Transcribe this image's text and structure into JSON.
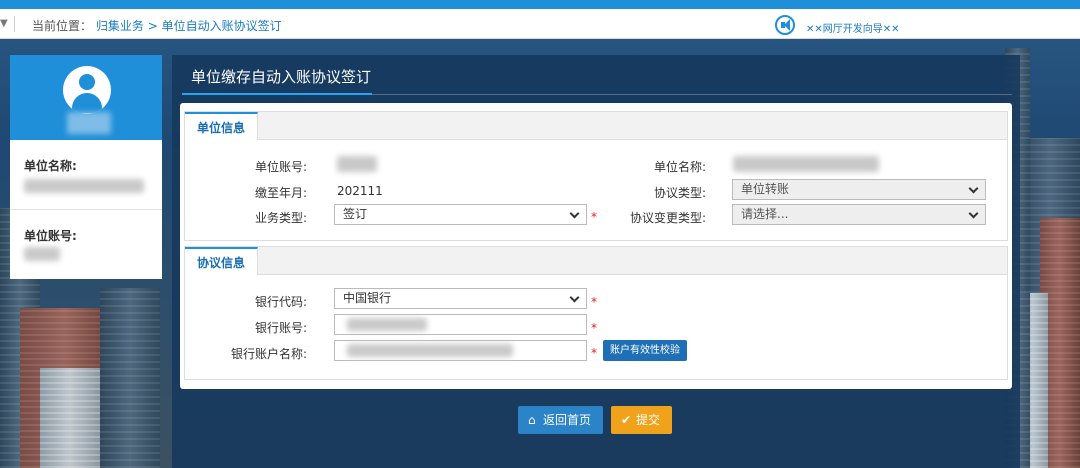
{
  "breadcrumb": {
    "prefix": "当前位置：",
    "level1": "归集业务",
    "separator": ">",
    "level2": "单位自动入账协议签订"
  },
  "guide_link": "✕✕网厅开发向导✕✕",
  "sidebar": {
    "unit_name_label": "单位名称:",
    "unit_account_label": "单位账号:"
  },
  "panel": {
    "title": "单位缴存自动入账协议签订"
  },
  "unit_info": {
    "section_title": "单位信息",
    "account_label": "单位账号:",
    "name_label": "单位名称:",
    "paid_until_label": "缴至年月:",
    "paid_until_value": "202111",
    "agreement_type_label": "协议类型:",
    "agreement_type_value": "单位转账",
    "business_type_label": "业务类型:",
    "business_type_value": "签订",
    "change_type_label": "协议变更类型:",
    "change_type_placeholder": "请选择..."
  },
  "agreement_info": {
    "section_title": "协议信息",
    "bank_code_label": "银行代码:",
    "bank_code_value": "中国银行",
    "bank_account_label": "银行账号:",
    "bank_account_name_label": "银行账户名称:",
    "verify_button": "账户有效性校验"
  },
  "required_mark": "*",
  "buttons": {
    "home": "返回首页",
    "submit": "提交"
  },
  "colors": {
    "accent": "#1e8fd8",
    "submit": "#f0a31a",
    "required": "#e02020"
  }
}
